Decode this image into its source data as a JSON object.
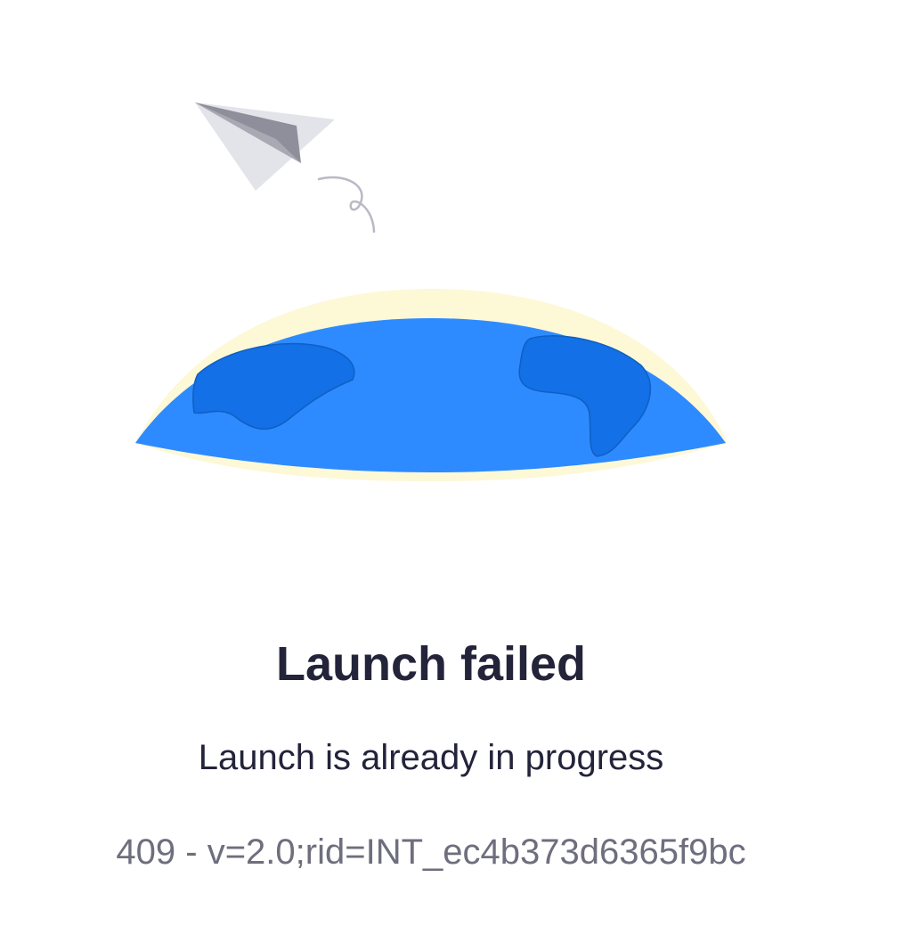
{
  "error": {
    "title": "Launch failed",
    "message": "Launch is already in progress",
    "code_line": "409 - v=2.0;rid=INT_ec4b373d6365f9bc"
  },
  "illustration": {
    "icons": [
      "paper-plane-icon",
      "globe-icon"
    ],
    "colors": {
      "ocean": "#2e8bff",
      "land": "#1370e6",
      "glow": "#fdf8d6",
      "plane_light": "#e3e3ea",
      "plane_dark": "#8f8f9b",
      "trail": "#b9b9c6"
    }
  }
}
